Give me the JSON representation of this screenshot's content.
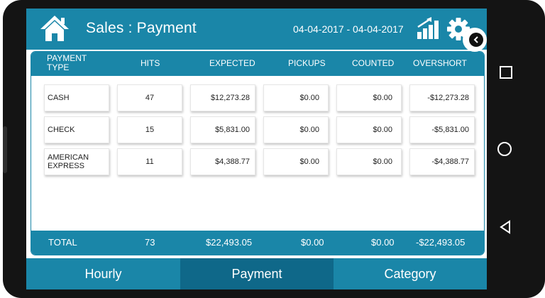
{
  "header": {
    "title": "Sales : Payment",
    "date_range": "04-04-2017 - 04-04-2017",
    "icons": {
      "home": "home-icon",
      "chart": "bar-chart-icon",
      "settings": "gear-icon"
    }
  },
  "table": {
    "columns": [
      "PAYMENT TYPE",
      "HITS",
      "EXPECTED",
      "PICKUPS",
      "COUNTED",
      "OVERSHORT"
    ],
    "column_type_lines": [
      "PAYMENT",
      "TYPE"
    ],
    "rows": [
      {
        "type_lines": [
          "CASH"
        ],
        "hits": "47",
        "expected": "$12,273.28",
        "pickups": "$0.00",
        "counted": "$0.00",
        "overshort": "-$12,273.28"
      },
      {
        "type_lines": [
          "CHECK"
        ],
        "hits": "15",
        "expected": "$5,831.00",
        "pickups": "$0.00",
        "counted": "$0.00",
        "overshort": "-$5,831.00"
      },
      {
        "type_lines": [
          "AMERICAN",
          "EXPRESS"
        ],
        "hits": "11",
        "expected": "$4,388.77",
        "pickups": "$0.00",
        "counted": "$0.00",
        "overshort": "-$4,388.77"
      }
    ],
    "total": {
      "label": "TOTAL",
      "hits": "73",
      "expected": "$22,493.05",
      "pickups": "$0.00",
      "counted": "$0.00",
      "overshort": "-$22,493.05"
    }
  },
  "tabs": [
    {
      "label": "Hourly",
      "active": false
    },
    {
      "label": "Payment",
      "active": true
    },
    {
      "label": "Category",
      "active": false
    }
  ],
  "colors": {
    "primary": "#1a86a8",
    "active_tab": "#0f6889",
    "frame": "#141414"
  }
}
